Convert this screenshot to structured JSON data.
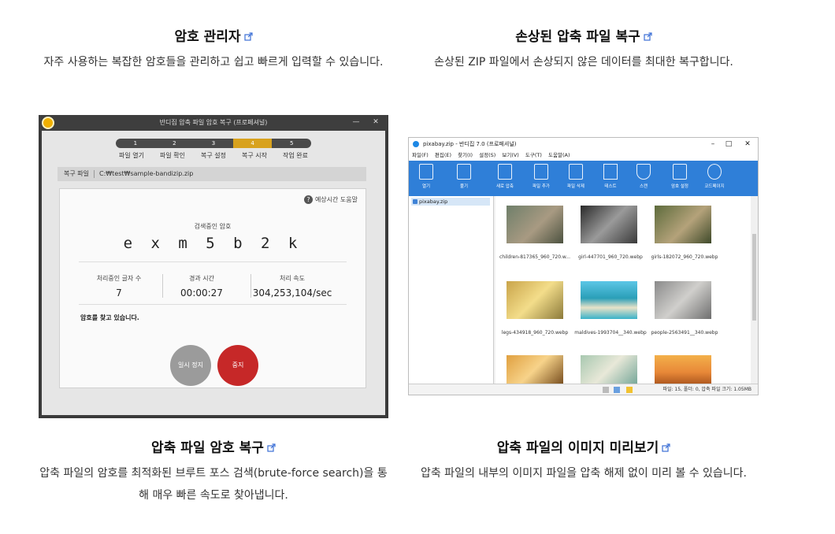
{
  "features": [
    {
      "title": "암호 관리자",
      "desc": "자주 사용하는 복잡한 암호들을 관리하고 쉽고 빠르게 입력할 수 있습니다."
    },
    {
      "title": "손상된 압축 파일 복구",
      "desc": "손상된 ZIP 파일에서 손상되지 않은 데이터를 최대한 복구합니다."
    },
    {
      "title": "압축 파일 암호 복구",
      "desc": "압축 파일의 암호를 최적화된 브루트 포스 검색(brute-force search)을 통해 매우 빠른 속도로 찾아냅니다."
    },
    {
      "title": "압축 파일의 이미지 미리보기",
      "desc": "압축 파일의 내부의 이미지 파일을 압축 해제 없이 미리 볼 수 있습니다."
    }
  ],
  "recovery_window": {
    "title": "반디집 압축 파일 암호 복구 (프로페셔널)",
    "steps": [
      "1",
      "2",
      "3",
      "4",
      "5"
    ],
    "step_labels": [
      "파일 열기",
      "파일 확인",
      "복구 설정",
      "복구 시작",
      "작업 완료"
    ],
    "path_label": "복구 파일",
    "path_value": "C:₩test₩sample-bandizip.zip",
    "help_label": "예상시간 도움말",
    "searching_label": "검색중인 암호",
    "password": "e x m 5 b 2 k",
    "stats": [
      {
        "label": "처리중인 글자 수",
        "value": "7"
      },
      {
        "label": "경과 시간",
        "value": "00:00:27"
      },
      {
        "label": "처리 속도",
        "value": "304,253,104/sec"
      }
    ],
    "status_text": "암호를 찾고 있습니다.",
    "pause_label": "일시 정지",
    "stop_label": "중지"
  },
  "viewer_window": {
    "title": "pixabay.zip - 반디집 7.0 (프로페셔널)",
    "menu": [
      "파일(F)",
      "편집(E)",
      "찾기(I)",
      "설정(S)",
      "보기(V)",
      "도구(T)",
      "도움말(A)"
    ],
    "toolbar": [
      "열기",
      "풀기",
      "새로 압축",
      "파일 추가",
      "파일 삭제",
      "테스트",
      "스캔",
      "암호 설정",
      "코드페이지"
    ],
    "tree_item": "pixabay.zip",
    "files": [
      "children-817365_960_720.w...",
      "girl-447701_960_720.webp",
      "girls-182072_960_720.webp",
      "legs-434918_960_720.webp",
      "maldives-1993704__340.webp",
      "people-2563491__340.webp"
    ],
    "status_text": "파일: 15, 폴더: 0, 압축 파일 크기: 1.05MB"
  }
}
